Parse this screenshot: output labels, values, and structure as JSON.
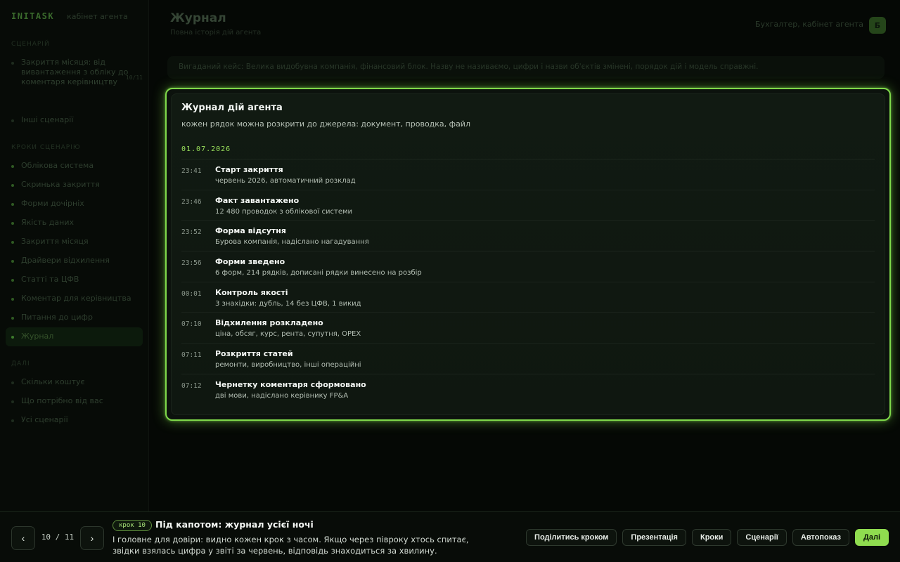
{
  "sidebar": {
    "brand": "INITASK",
    "brand_sub": "кабінет агента",
    "section_scenario": "СЦЕНАРІЙ",
    "scenario_item": "Закриття місяця: від вивантаження з обліку до коментаря керівництву",
    "scenario_tag": "10/11",
    "scenario_other": "Інші сценарії",
    "section_steps": "КРОКИ СЦЕНАРІЮ",
    "steps": [
      {
        "label": "Облікова система"
      },
      {
        "label": "Скринька закриття"
      },
      {
        "label": "Форми дочірніх"
      },
      {
        "label": "Якість даних"
      },
      {
        "label": "Закриття місяця"
      },
      {
        "label": "Драйвери відхилення"
      },
      {
        "label": "Статті та ЦФВ"
      },
      {
        "label": "Коментар для керівництва"
      },
      {
        "label": "Питання до цифр"
      },
      {
        "label": "Журнал"
      }
    ],
    "section_more": "ДАЛІ",
    "more": [
      {
        "label": "Скільки коштує"
      },
      {
        "label": "Що потрібно від вас"
      },
      {
        "label": "Усі сценарії"
      }
    ]
  },
  "header": {
    "title": "Журнал",
    "subtitle": "Повна історія дій агента",
    "user": "Бухгалтер, кабінет агента",
    "avatar": "Б"
  },
  "banner": "Вигаданий кейс: Велика видобувна компанія, фінансовий блок. Назву не називаємо, цифри і назви об'єктів змінені, порядок дій і модель справжні.",
  "journal": {
    "title": "Журнал дій агента",
    "subtitle": "кожен рядок можна розкрити до джерела: документ, проводка, файл",
    "date": "01.07.2026",
    "rows": [
      {
        "time": "23:41",
        "title": "Старт закриття",
        "detail": "червень 2026, автоматичний розклад"
      },
      {
        "time": "23:46",
        "title": "Факт завантажено",
        "detail": "12 480 проводок з облікової системи"
      },
      {
        "time": "23:52",
        "title": "Форма відсутня",
        "detail": "Бурова компанія, надіслано нагадування"
      },
      {
        "time": "23:56",
        "title": "Форми зведено",
        "detail": "6 форм, 214 рядків, дописані рядки винесено на розбір"
      },
      {
        "time": "00:01",
        "title": "Контроль якості",
        "detail": "3 знахідки: дубль, 14 без ЦФВ, 1 викид"
      },
      {
        "time": "07:10",
        "title": "Відхилення розкладено",
        "detail": "ціна, обсяг, курс, рента, супутня, OPEX"
      },
      {
        "time": "07:11",
        "title": "Розкриття статей",
        "detail": "ремонти, виробництво, інші операційні"
      },
      {
        "time": "07:12",
        "title": "Чернетку коментаря сформовано",
        "detail": "дві мови, надіслано керівнику FP&A"
      }
    ]
  },
  "tour": {
    "prev_icon": "‹",
    "next_icon": "›",
    "counter": "10 / 11",
    "step_badge": "крок 10",
    "step_title": "Під капотом: журнал усієї ночі",
    "step_desc": "І головне для довіри: видно кожен крок з часом. Якщо через півроку хтось спитає, звідки взялась цифра у звіті за червень, відповідь знаходиться за хвилину.",
    "buttons": {
      "share": "Поділитись кроком",
      "presentation": "Презентація",
      "steps": "Кроки",
      "scenarios": "Сценарії",
      "autoplay": "Автопоказ",
      "next": "Далі"
    }
  },
  "colors": {
    "accent": "#8fdc4f",
    "highlight_border": "#7fd94a",
    "background": "#050805"
  }
}
